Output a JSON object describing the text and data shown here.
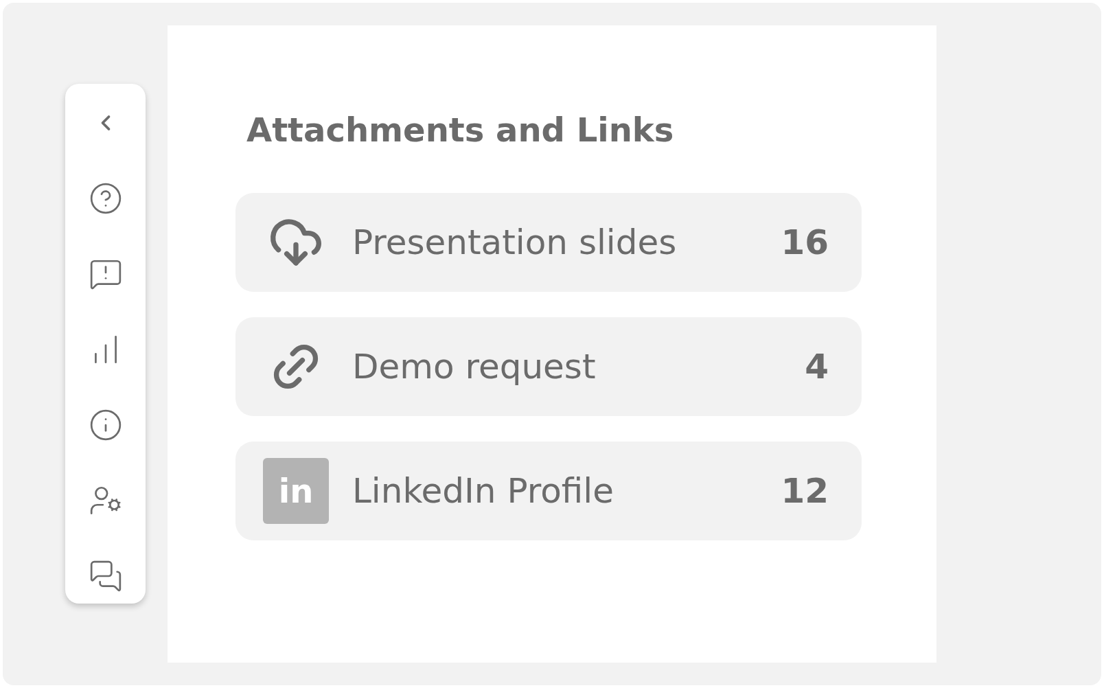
{
  "sidebar": {
    "items": [
      {
        "kind": "collapse"
      },
      {
        "kind": "help"
      },
      {
        "kind": "feedback"
      },
      {
        "kind": "stats"
      },
      {
        "kind": "info"
      },
      {
        "kind": "user-settings"
      },
      {
        "kind": "chat"
      }
    ]
  },
  "panel": {
    "title": "Attachments and Links",
    "items": [
      {
        "kind": "download",
        "label": "Presentation slides",
        "count": "16"
      },
      {
        "kind": "link",
        "label": "Demo request",
        "count": "4"
      },
      {
        "kind": "linkedin",
        "logo_text": "in",
        "label": "LinkedIn Profile",
        "count": "12"
      }
    ]
  }
}
